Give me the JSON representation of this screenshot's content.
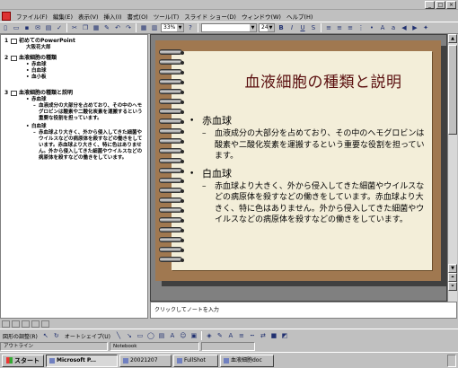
{
  "menubar": {
    "items": [
      "ファイル(F)",
      "編集(E)",
      "表示(V)",
      "挿入(I)",
      "書式(O)",
      "ツール(T)",
      "スライド ショー(D)",
      "ウィンドウ(W)",
      "ヘルプ(H)"
    ]
  },
  "toolbar": {
    "zoom": "33%",
    "font_size": "24"
  },
  "outline": {
    "slides": [
      {
        "num": "1",
        "title": "初めてのPowerPoint",
        "lines": [
          {
            "bullet": "",
            "text": "大阪花大郎"
          }
        ]
      },
      {
        "num": "2",
        "title": "血液細胞の種類",
        "lines": [
          {
            "bullet": "•",
            "text": "赤血球"
          },
          {
            "bullet": "•",
            "text": "白血球"
          },
          {
            "bullet": "•",
            "text": "血小板"
          }
        ]
      },
      {
        "num": "3",
        "title": "血液細胞の種類と説明",
        "lines": [
          {
            "bullet": "•",
            "text": "赤血球"
          },
          {
            "bullet": "–",
            "text": "血液成分の大部分を占めており、その中のヘモグロビンは酸素や二酸化炭素を運搬するという重要な役割を担っています。"
          },
          {
            "bullet": "•",
            "text": "白血球"
          },
          {
            "bullet": "–",
            "text": "赤血球より大きく、外から侵入してきた細菌やウイルスなどの病原体を殺すなどの働きをしています。赤血球より大きく、特に色はありません。外から侵入してきた細菌やウイルスなどの病原体を殺すなどの働きをしています。"
          }
        ]
      }
    ]
  },
  "slide": {
    "title": "血液細胞の種類と説明",
    "bullets": [
      {
        "heading": "赤血球",
        "detail": "血液成分の大部分を占めており、その中のヘモグロビンは酸素や二酸化炭素を運搬するという重要な役割を担っています。"
      },
      {
        "heading": "白血球",
        "detail": "赤血球より大きく、外から侵入してきた細菌やウイルスなどの病原体を殺すなどの働きをしています。赤血球より大きく、特に色はありません。外から侵入してきた細菌やウイルスなどの病原体を殺すなどの働きをしています。"
      }
    ]
  },
  "notes": {
    "placeholder": "クリックしてノートを入力"
  },
  "drawbar": {
    "draw_label": "図形の調整(R)",
    "autoshape_label": "オートシェイプ(U)"
  },
  "status": {
    "view": "アウトライン",
    "template": "Notebook"
  },
  "taskbar": {
    "start": "スタート",
    "items": [
      "Microsoft P...",
      "20021207",
      "FullShot",
      "血液細胞doc"
    ],
    "active": 0
  }
}
